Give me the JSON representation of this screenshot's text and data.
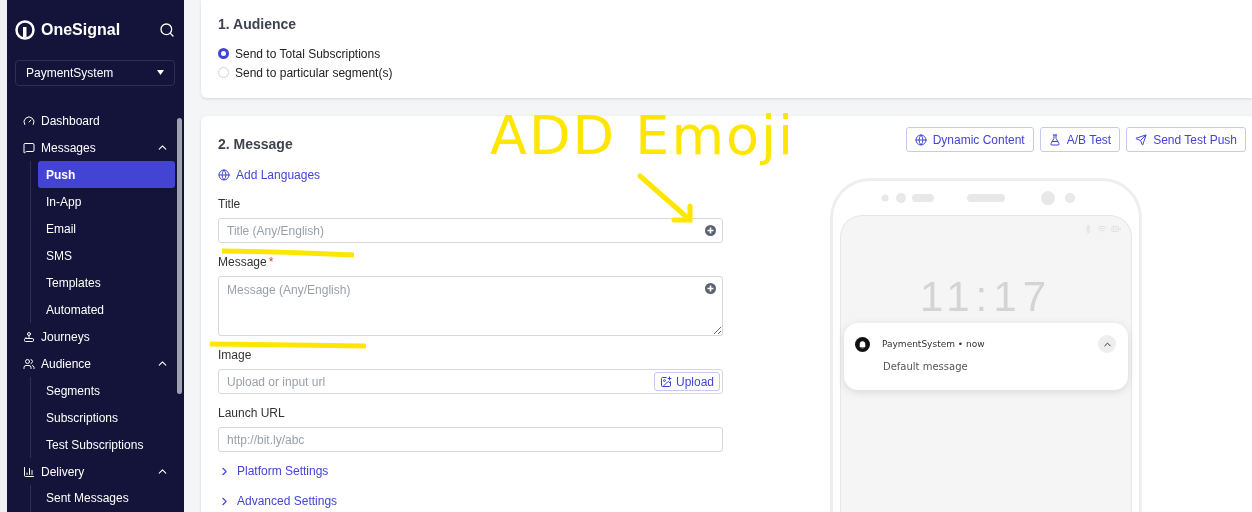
{
  "sidebar": {
    "brand": "OneSignal",
    "project": "PaymentSystem",
    "items": [
      {
        "label": "Dashboard",
        "selected": false
      },
      {
        "label": "Messages",
        "expanded": true,
        "selected": false,
        "children": [
          {
            "label": "Push",
            "selected": true
          },
          {
            "label": "In-App",
            "selected": false
          },
          {
            "label": "Email",
            "selected": false
          },
          {
            "label": "SMS",
            "selected": false
          },
          {
            "label": "Templates",
            "selected": false
          },
          {
            "label": "Automated",
            "selected": false
          }
        ]
      },
      {
        "label": "Journeys",
        "selected": false
      },
      {
        "label": "Audience",
        "expanded": true,
        "selected": false,
        "children": [
          {
            "label": "Segments",
            "selected": false
          },
          {
            "label": "Subscriptions",
            "selected": false
          },
          {
            "label": "Test Subscriptions",
            "selected": false
          }
        ]
      },
      {
        "label": "Delivery",
        "expanded": true,
        "selected": false,
        "children": [
          {
            "label": "Sent Messages",
            "selected": false
          }
        ]
      }
    ]
  },
  "audience": {
    "title": "1. Audience",
    "options": [
      {
        "label": "Send to Total Subscriptions",
        "selected": true
      },
      {
        "label": "Send to particular segment(s)",
        "selected": false
      }
    ]
  },
  "message": {
    "title": "2. Message",
    "add_languages": "Add Languages",
    "actions": [
      "Dynamic Content",
      "A/B Test",
      "Send Test Push"
    ],
    "fields": [
      {
        "kind": "input",
        "label": "Title",
        "placeholder": "Title (Any/English)",
        "emoji": true
      },
      {
        "kind": "textarea",
        "label": "Message",
        "required_mark": "*",
        "placeholder": "Message (Any/English)",
        "emoji": true
      },
      {
        "kind": "upload",
        "label": "Image",
        "placeholder": "Upload or input url",
        "button": "Upload"
      },
      {
        "kind": "input",
        "label": "Launch URL",
        "placeholder": "http://bit.ly/abc"
      }
    ],
    "sections": [
      "Platform Settings",
      "Advanced Settings"
    ],
    "preview": {
      "clock": "11:17",
      "app": "PaymentSystem • now",
      "body": "Default message"
    }
  },
  "annotation": {
    "text": "ADD Emoji"
  }
}
